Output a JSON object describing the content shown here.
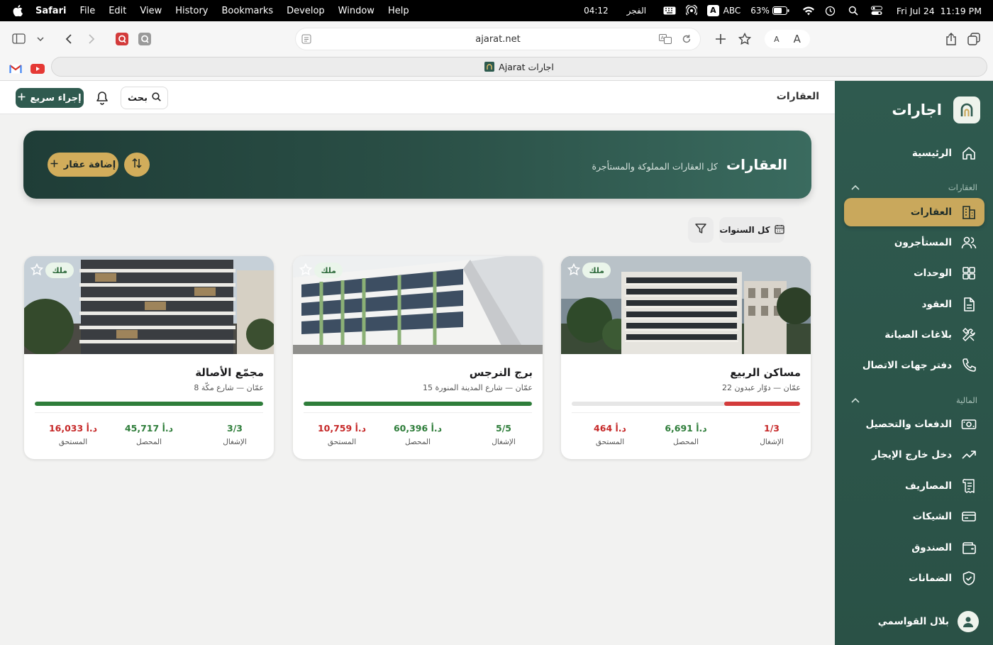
{
  "menubar": {
    "app": "Safari",
    "items": [
      "File",
      "Edit",
      "View",
      "History",
      "Bookmarks",
      "Develop",
      "Window",
      "Help"
    ],
    "prayer_time": "04:12",
    "prayer_name": "الفجر",
    "input_source": "ABC",
    "battery": "63%",
    "datetime": "Fri Jul 24  11:19 PM"
  },
  "browser": {
    "url": "ajarat.net",
    "tab_title": "Ajarat اجارات",
    "font_small": "A",
    "font_large": "A"
  },
  "sidebar": {
    "brand": "اجارات",
    "home": "الرئيسية",
    "section_properties": "العقارات",
    "nav": [
      {
        "label": "العقارات",
        "icon": "building-icon"
      },
      {
        "label": "المستأجرون",
        "icon": "users-icon"
      },
      {
        "label": "الوحدات",
        "icon": "grid-icon"
      },
      {
        "label": "العقود",
        "icon": "document-icon"
      },
      {
        "label": "بلاغات الصيانة",
        "icon": "tools-icon"
      },
      {
        "label": "دفتر جهات الاتصال",
        "icon": "phone-icon"
      }
    ],
    "section_finance": "المالية",
    "finance": [
      {
        "label": "الدفعات والتحصيل",
        "icon": "cash-icon"
      },
      {
        "label": "دخل خارج الإيجار",
        "icon": "trending-up-icon"
      },
      {
        "label": "المصاريف",
        "icon": "receipt-icon"
      },
      {
        "label": "الشيكات",
        "icon": "card-icon"
      },
      {
        "label": "الصندوق",
        "icon": "wallet-icon"
      },
      {
        "label": "الضمانات",
        "icon": "shield-check-icon"
      }
    ],
    "user_name": "بلال القواسمي"
  },
  "header": {
    "title": "العقارات",
    "search_label": "بحث",
    "quick_action_label": "إجراء سريع"
  },
  "banner": {
    "title": "العقارات",
    "subtitle": "كل العقارات المملوكة والمستأجرة",
    "add_label": "إضافة عقار"
  },
  "filters": {
    "years_label": "كل السنوات"
  },
  "stat_labels": {
    "occupancy": "الإشغال",
    "collected": "المحصل",
    "due": "المستحق"
  },
  "properties": [
    {
      "name": "مساكن الربيع",
      "location": "عمّان — دوّار عبدون 22",
      "tag": "ملك",
      "occupancy": "1/3",
      "occupancy_ratio": 0.333,
      "collected": "6,691 د.أ",
      "due": "464 د.أ",
      "bar_color": "#d33b3b"
    },
    {
      "name": "برج النرجس",
      "location": "عمّان — شارع المدينة المنورة 15",
      "tag": "ملك",
      "occupancy": "5/5",
      "occupancy_ratio": 1.0,
      "collected": "60,396 د.أ",
      "due": "10,759 د.أ",
      "bar_color": "#2e7d3a"
    },
    {
      "name": "مجمّع الأصالة",
      "location": "عمّان — شارع مكّة 8",
      "tag": "ملك",
      "occupancy": "3/3",
      "occupancy_ratio": 1.0,
      "collected": "45,717 د.أ",
      "due": "16,033 د.أ",
      "bar_color": "#2e7d3a"
    }
  ],
  "colors": {
    "sidebar": "#2f5a4f",
    "accent_gold": "#c9a85c",
    "stat_green": "#2e7d3a",
    "stat_red": "#c62828"
  }
}
